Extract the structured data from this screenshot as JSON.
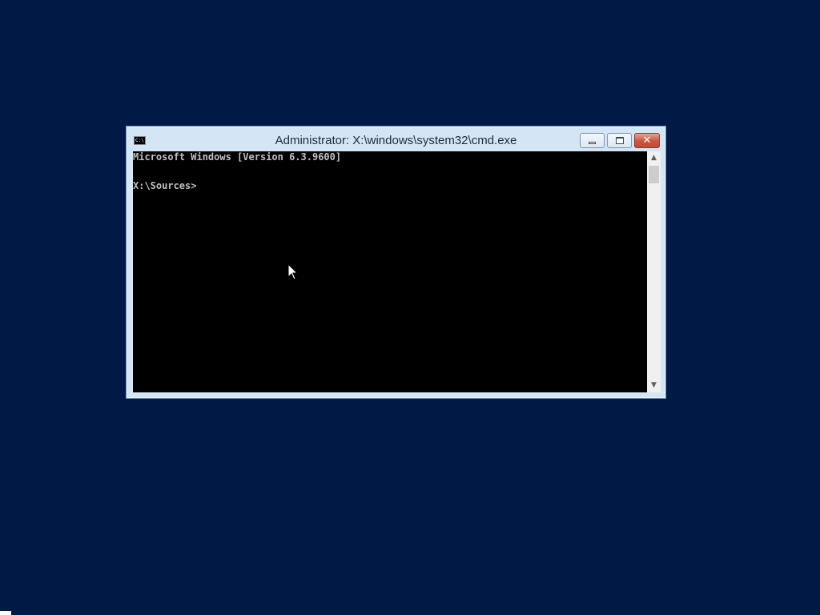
{
  "window": {
    "title": "Administrator: X:\\windows\\system32\\cmd.exe",
    "app_icon_text": "C:\\"
  },
  "console": {
    "lines": [
      "Microsoft Windows [Version 6.3.9600]",
      "X:\\Sources>"
    ]
  },
  "icons": {
    "minimize": "minimize-icon",
    "maximize": "maximize-icon",
    "close": "close-icon",
    "cursor": "mouse-pointer-icon"
  },
  "colors": {
    "desktop": "#011a45",
    "window_frame": "#d4e6f5",
    "console_bg": "#000000",
    "console_text": "#c0c0c0",
    "close_button": "#c9553d"
  }
}
